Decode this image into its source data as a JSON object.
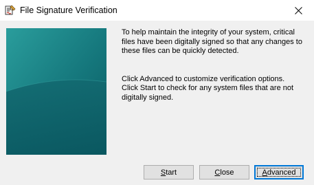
{
  "window": {
    "title": "File Signature Verification",
    "icons": {
      "app": "signature-verification-icon",
      "close": "close-icon"
    }
  },
  "content": {
    "paragraph_1": "To help maintain the integrity of your system, critical files have been digitally signed so that any changes to these files can be quickly detected.",
    "paragraph_2_line_1": "Click Advanced to customize verification options.",
    "paragraph_2_line_2": "Click Start to check for any system files that are not digitally signed."
  },
  "buttons": {
    "start": {
      "accel": "S",
      "rest": "tart"
    },
    "close": {
      "accel": "C",
      "rest": "lose"
    },
    "advanced": {
      "accel": "A",
      "rest": "dvanced"
    }
  },
  "colors": {
    "banner_light": "#1f8a8c",
    "banner_dark": "#0b5c62",
    "focus_accent": "#0078d7"
  }
}
